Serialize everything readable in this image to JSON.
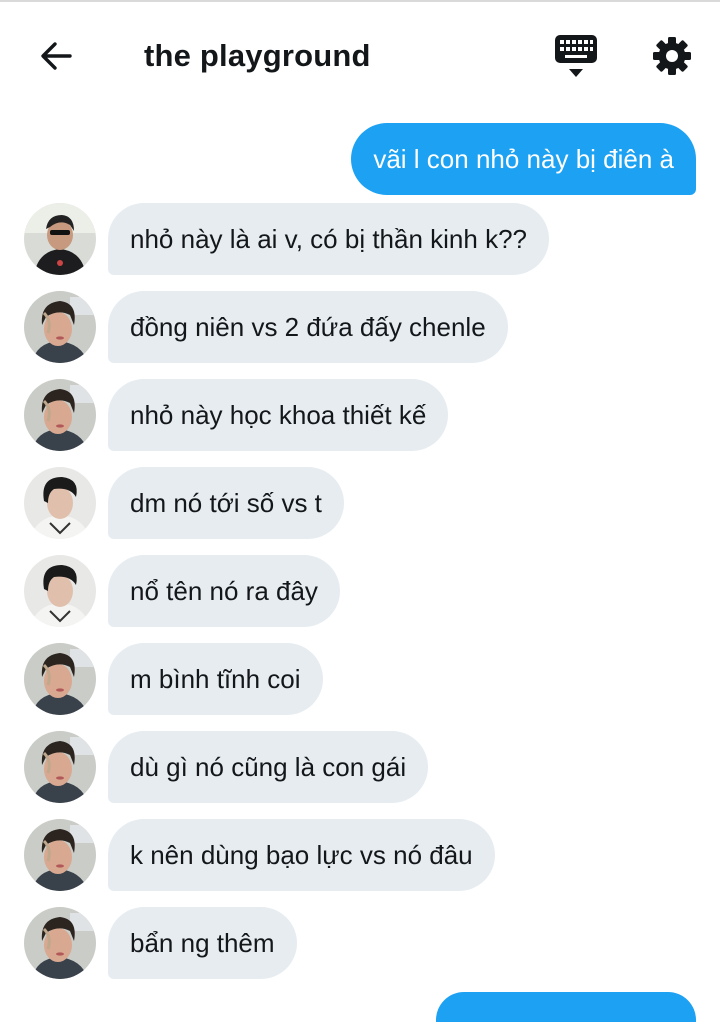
{
  "header": {
    "title": "the playground",
    "back_icon": "arrow-left-icon",
    "keyboard_icon": "keyboard-icon",
    "settings_icon": "gear-icon"
  },
  "colors": {
    "sent_bubble": "#1da1f2",
    "received_bubble": "#e6ecf0",
    "text": "#14171a"
  },
  "messages": [
    {
      "direction": "sent",
      "text": "vãi l con nhỏ này bị điên à"
    },
    {
      "direction": "received",
      "avatar": "avatar-a",
      "text": "nhỏ này là ai v, có bị thần kinh k??"
    },
    {
      "direction": "received",
      "avatar": "avatar-b",
      "text": "đồng niên vs 2 đứa đấy chenle"
    },
    {
      "direction": "received",
      "avatar": "avatar-b",
      "text": "nhỏ này học khoa thiết kế"
    },
    {
      "direction": "received",
      "avatar": "avatar-c",
      "text": "dm nó tới số vs t"
    },
    {
      "direction": "received",
      "avatar": "avatar-c",
      "text": "nổ tên nó ra đây"
    },
    {
      "direction": "received",
      "avatar": "avatar-b",
      "text": "m bình tĩnh coi"
    },
    {
      "direction": "received",
      "avatar": "avatar-b",
      "text": "dù gì nó cũng là con gái"
    },
    {
      "direction": "received",
      "avatar": "avatar-b",
      "text": "k nên dùng bạo lực vs nó đâu"
    },
    {
      "direction": "received",
      "avatar": "avatar-b",
      "text": "bẩn ng thêm"
    }
  ]
}
